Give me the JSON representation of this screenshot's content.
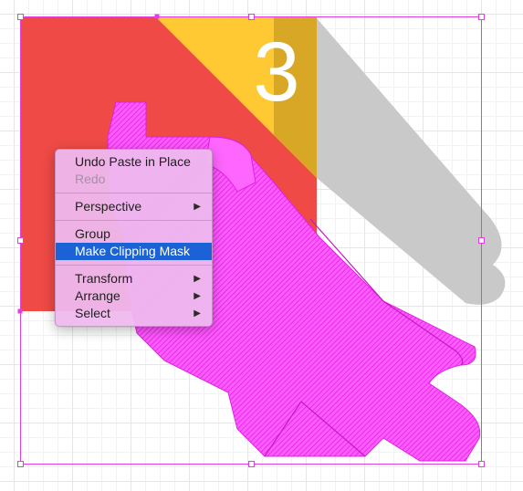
{
  "artboard": {
    "badge_number": "3",
    "colors": {
      "red": "#ef4a46",
      "yellow": "#ffc933",
      "dark_yellow": "#d7a725",
      "gray_shadow": "#c9c9c9",
      "magenta": "#ff33ff",
      "selection": "#e040e0",
      "menu_highlight": "#1b62d6"
    }
  },
  "context_menu": {
    "items": [
      {
        "label": "Undo Paste in Place",
        "enabled": true,
        "submenu": false
      },
      {
        "label": "Redo",
        "enabled": false,
        "submenu": false
      },
      {
        "label": "Perspective",
        "enabled": true,
        "submenu": true,
        "arrow": "▶"
      },
      {
        "label": "Group",
        "enabled": true,
        "submenu": false
      },
      {
        "label": "Make Clipping Mask",
        "enabled": true,
        "submenu": false,
        "highlighted": true
      },
      {
        "label": "Transform",
        "enabled": true,
        "submenu": true,
        "arrow": "▶"
      },
      {
        "label": "Arrange",
        "enabled": true,
        "submenu": true,
        "arrow": "▶"
      },
      {
        "label": "Select",
        "enabled": true,
        "submenu": true,
        "arrow": "▶"
      }
    ]
  }
}
